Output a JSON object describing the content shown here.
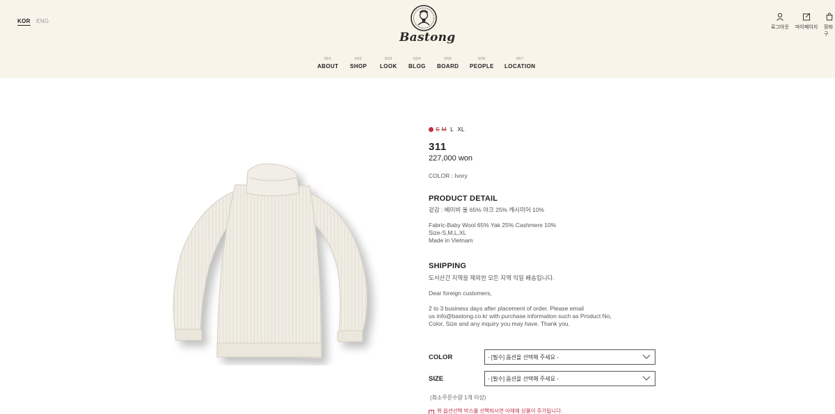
{
  "header": {
    "lang": {
      "kor": "KOR",
      "eng": "ENG"
    },
    "logo_text": "Bastong",
    "utils": [
      {
        "label": "로그아웃",
        "icon": "user-icon"
      },
      {
        "label": "마이페이지",
        "icon": "mypage-icon"
      },
      {
        "label": "장바구",
        "icon": "cart-icon"
      }
    ],
    "nav": [
      {
        "num": "001",
        "label": "ABOUT"
      },
      {
        "num": "002",
        "label": "SHOP"
      },
      {
        "num": "003",
        "label": "LOOK"
      },
      {
        "num": "004",
        "label": "BLOG"
      },
      {
        "num": "005",
        "label": "BOARD"
      },
      {
        "num": "006",
        "label": "PEOPLE"
      },
      {
        "num": "007",
        "label": "LOCATION"
      }
    ]
  },
  "product": {
    "sizes": [
      {
        "label": "S",
        "soldout": true
      },
      {
        "label": "M",
        "soldout": true
      },
      {
        "label": "L",
        "soldout": false
      },
      {
        "label": "XL",
        "soldout": false
      }
    ],
    "name": "311",
    "price": "227,000 won",
    "color": "COLOR : Ivory",
    "detail_title": "PRODUCT DETAIL",
    "detail_lines": [
      "겉감 : 베이비 울 65% 야크 25% 캐시미어 10%",
      "",
      "Fabric-Baby Wool 65% Yak 25% Cashmere 10%",
      "Size-S,M,L,XL",
      "Made in Vietnam"
    ],
    "shipping_title": "SHIPPING",
    "shipping_kr": "도서산간 지역을 제외한 모든 지역 익일 배송입니다.",
    "shipping_dear": "Dear foreign customers,",
    "shipping_lines": [
      "2 to 3 business days after placement of order. Please email",
      "us info@bastong.co.kr with purchase information such as Product No,",
      "Color, Size and any inquiry you may have. Thank you."
    ]
  },
  "options": {
    "color_label": "COLOR",
    "size_label": "SIZE",
    "placeholder": "- [필수] 옵션을 선택해 주세요 -",
    "min_qty": "(최소주문수량 1개 이상)",
    "notice": "위 옵션선택 박스를 선택하시면 아래에 상품이 추가됩니다.",
    "notice_icon": "!"
  }
}
